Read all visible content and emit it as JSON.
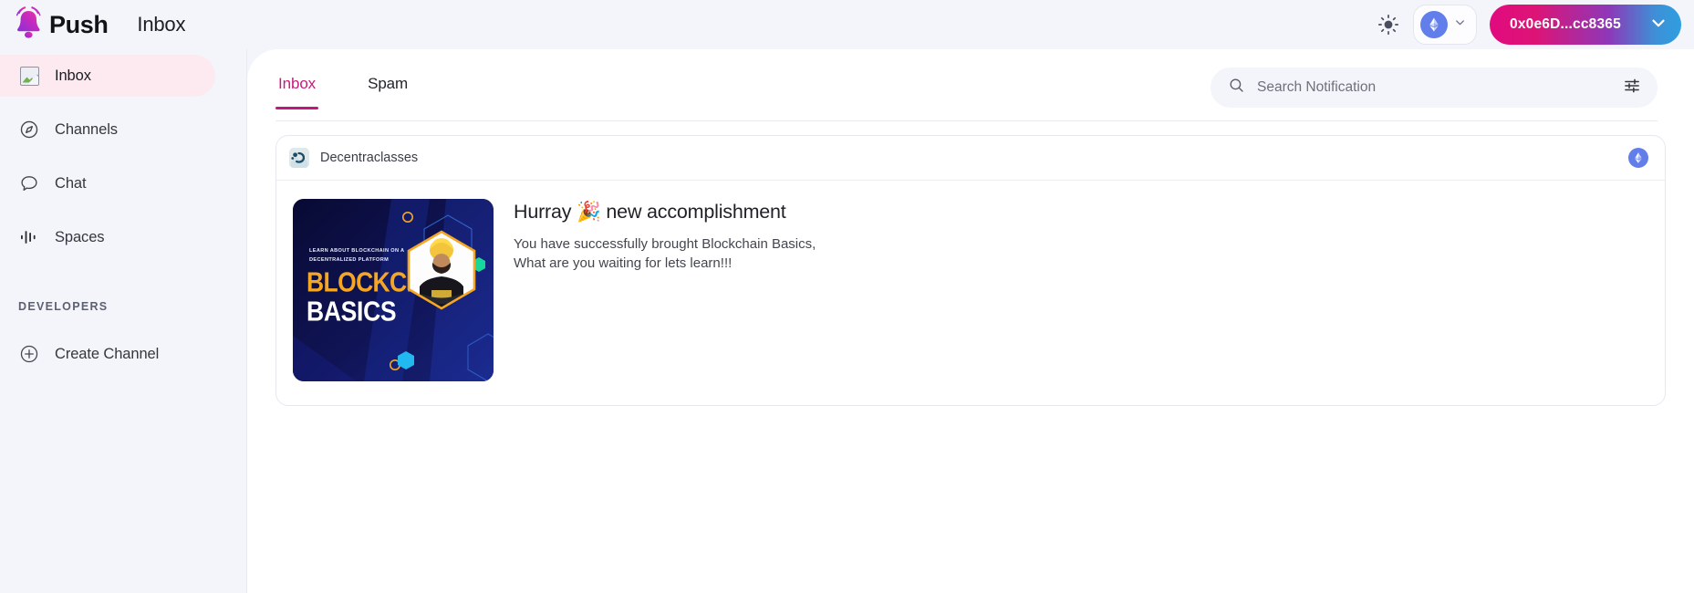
{
  "brand": {
    "logo_icon": "push-bell-icon",
    "name": "Push",
    "page_title": "Inbox"
  },
  "topbar": {
    "theme_toggle_icon": "sun-icon",
    "chain_selector": {
      "icon": "ethereum-icon",
      "chevron_icon": "chevron-down-icon"
    },
    "wallet": {
      "address": "0x0e6D...cc8365",
      "chevron_icon": "chevron-down-icon",
      "gradient_start": "#e10a7f",
      "gradient_end": "#2e9fe0"
    }
  },
  "sidebar": {
    "items": [
      {
        "label": "Inbox",
        "icon": "broken-image-icon",
        "active": true
      },
      {
        "label": "Channels",
        "icon": "compass-icon",
        "active": false
      },
      {
        "label": "Chat",
        "icon": "chat-bubble-icon",
        "active": false
      },
      {
        "label": "Spaces",
        "icon": "audio-bars-icon",
        "active": false
      }
    ],
    "section_label": "DEVELOPERS",
    "dev_items": [
      {
        "label": "Create Channel",
        "icon": "plus-circle-icon"
      }
    ],
    "active_bg": "#fdeaf1"
  },
  "main": {
    "tabs": [
      {
        "label": "Inbox",
        "active": true
      },
      {
        "label": "Spam",
        "active": false
      }
    ],
    "active_tab_color": "#c51b7d",
    "search": {
      "icon": "search-icon",
      "placeholder": "Search Notification",
      "value": "",
      "filter_icon": "sliders-filter-icon"
    },
    "notifications": [
      {
        "channel": "Decentraclasses",
        "channel_avatar_icon": "decentraclasses-avatar",
        "chain_icon": "ethereum-icon",
        "title": "Hurray 🎉 new accomplishment",
        "message": "You have successfully brought Blockchain Basics,\nWhat are you waiting for lets learn!!!",
        "thumbnail": {
          "alt": "blockchain-basics-banner",
          "kicker": "LEARN ABOUT BLOCKCHAIN ON A\nDECENTRALIZED PLATFORM",
          "heading_line1": "BLOCKCHAIN",
          "heading_line2": "BASICS",
          "bg_color": "#0d1040",
          "accent_color": "#f5a623"
        }
      }
    ]
  }
}
